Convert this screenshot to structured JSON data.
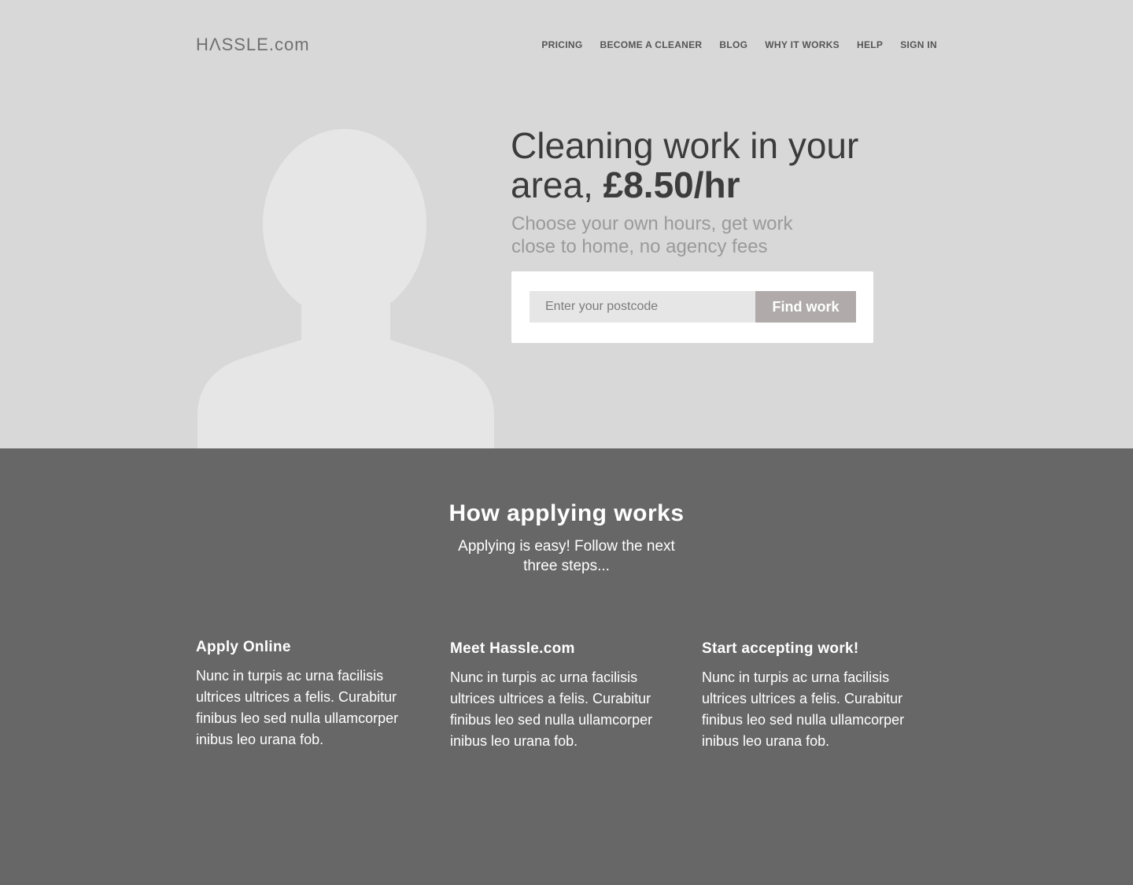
{
  "brand": {
    "logo": "HΛSSLE.com"
  },
  "nav": {
    "items": [
      "PRICING",
      "BECOME A CLEANER",
      "BLOG",
      "WHY IT WORKS",
      "HELP",
      "SIGN IN"
    ]
  },
  "hero": {
    "headline_part1": "Cleaning work in your area, ",
    "headline_price": "£8.50/hr",
    "subheadline": "Choose your own hours, get work close to home, no agency fees",
    "search": {
      "placeholder": "Enter your postcode",
      "value": "",
      "button_label": "Find work"
    }
  },
  "how": {
    "title": "How applying works",
    "subtitle": "Applying is easy! Follow the next three steps...",
    "steps": [
      {
        "title": "Apply Online",
        "text": "Nunc in turpis ac urna facilisis ultrices ultrices a felis. Curabitur finibus leo sed nulla ullamcorper inibus leo urana fob."
      },
      {
        "title": "Meet Hassle.com",
        "text": "Nunc in turpis ac urna facilisis ultrices ultrices a felis. Curabitur finibus leo sed nulla ullamcorper inibus leo urana fob."
      },
      {
        "title": "Start accepting work!",
        "text": "Nunc in turpis ac urna facilisis ultrices ultrices a felis. Curabitur finibus leo sed nulla ullamcorper inibus leo urana fob."
      }
    ]
  },
  "colors": {
    "hero_background": "#d8d8d8",
    "section_background": "#676767",
    "button_background": "#b0aaaa",
    "avatar_fill": "#e6e6e6"
  },
  "icons": {
    "avatar": "person-silhouette-icon"
  }
}
